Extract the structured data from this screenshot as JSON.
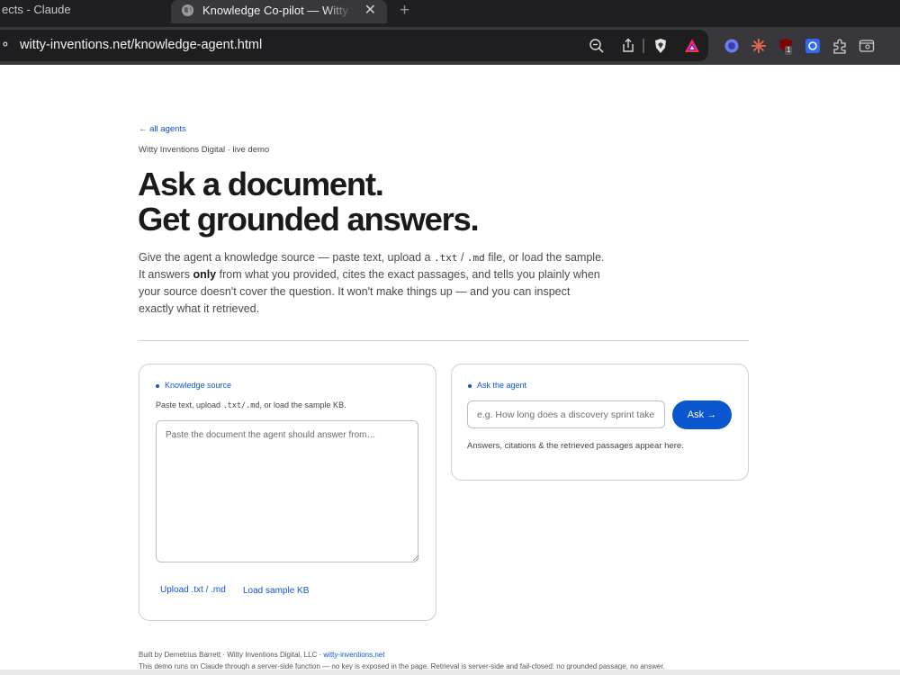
{
  "browser": {
    "inactive_tab": "ects - Claude",
    "active_tab": "Knowledge Co-pilot — Witty Inventions Digital",
    "close": "✕",
    "new_tab": "+",
    "url_lead": "⚬",
    "url": "witty-inventions.net/knowledge-agent.html",
    "extension_badge": "1"
  },
  "page": {
    "back_link": "← all agents",
    "eyebrow": "Witty Inventions Digital · live demo",
    "headline_line1": "Ask a document.",
    "headline_line2": "Get grounded answers.",
    "lede": {
      "p1": "Give the agent a knowledge source — paste text, upload a ",
      "code1": ".txt",
      "p2": " / ",
      "code2": ".md",
      "p3": " file, or load the sample. It answers ",
      "bold": "only",
      "p4": " from what you provided, cites the exact passages, and tells you plainly when your source doesn't cover the question. It won't make things up — and you can inspect exactly what it retrieved."
    }
  },
  "knowledge": {
    "label": "Knowledge source",
    "hint_pre": "Paste text, upload ",
    "hint_code": ".txt/.md",
    "hint_post": ", or load the sample KB.",
    "placeholder": "Paste the document the agent should answer from…",
    "upload_label": "Upload .txt / .md",
    "sample_label": "Load sample KB"
  },
  "ask": {
    "label": "Ask the agent",
    "placeholder": "e.g. How long does a discovery sprint take?",
    "button": "Ask →",
    "answers_text": "Answers, citations & the retrieved passages appear here."
  },
  "footer": {
    "built_by": "Built by Demetrius Barrett · Witty Inventions Digital, LLC · ",
    "site_link": "witty-inventions.net",
    "note": "This demo runs on Claude through a server-side function — no key is exposed in the page. Retrieval is server-side and fail-closed: no grounded passage, no answer."
  },
  "colors": {
    "accent": "#0b57d0",
    "chrome_dark": "#1f1f22",
    "chrome_mid": "#38383c"
  },
  "icons": [
    "globe-icon",
    "close-icon",
    "new-tab-icon",
    "zoom-out-icon",
    "share-icon",
    "brave-shield-icon",
    "brave-rewards-icon",
    "extension-icons",
    "puzzle-icon",
    "sidebar-icon"
  ]
}
